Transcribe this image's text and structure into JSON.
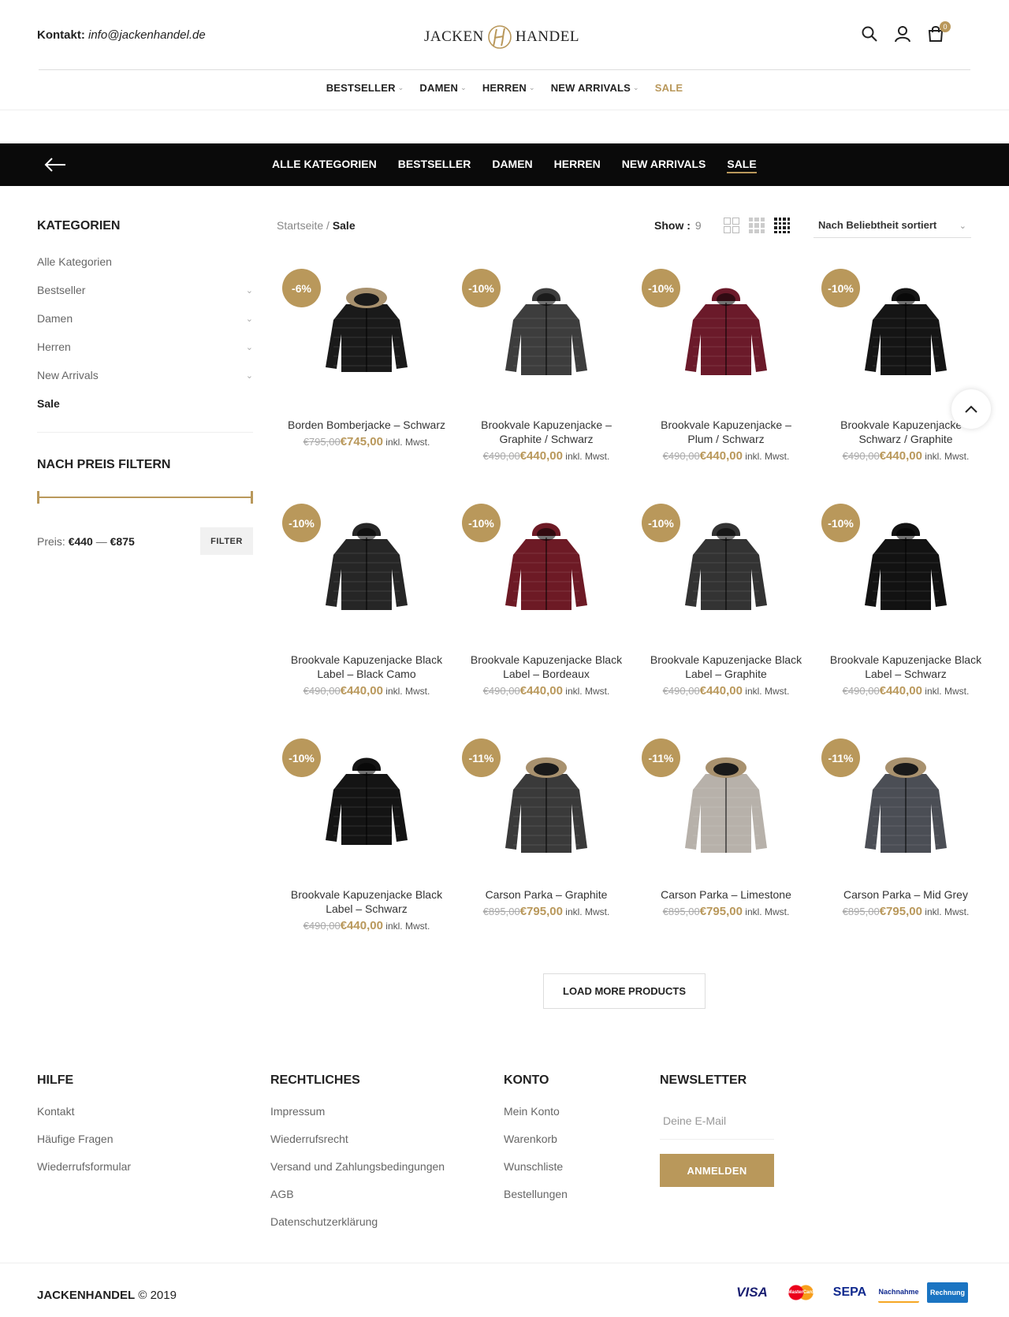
{
  "header": {
    "contact_label": "Kontakt:",
    "contact_email": "info@jackenhandel.de",
    "logo_left": "JACKEN",
    "logo_right": "HANDEL",
    "cart_count": "0"
  },
  "mainnav": [
    {
      "label": "BESTSELLER",
      "chev": "⌄"
    },
    {
      "label": "DAMEN",
      "chev": "⌄"
    },
    {
      "label": "HERREN",
      "chev": "⌄"
    },
    {
      "label": "NEW ARRIVALS",
      "chev": "⌄"
    },
    {
      "label": "SALE",
      "chev": ""
    }
  ],
  "catbar": {
    "items": [
      "ALLE KATEGORIEN",
      "BESTSELLER",
      "DAMEN",
      "HERREN",
      "NEW ARRIVALS",
      "SALE"
    ],
    "active": "SALE"
  },
  "sidebar": {
    "title": "KATEGORIEN",
    "items": [
      "Alle Kategorien",
      "Bestseller",
      "Damen",
      "Herren",
      "New Arrivals",
      "Sale"
    ],
    "price_title": "NACH PREIS FILTERN",
    "price_label": "Preis:",
    "price_min": "€440",
    "price_sep": "—",
    "price_max": "€875",
    "filter_button": "FILTER"
  },
  "toolbar": {
    "breadcrumb_home": "Startseite",
    "breadcrumb_sep": "/",
    "breadcrumb_current": "Sale",
    "show_label": "Show :",
    "show_value": "9",
    "sort_label": "Nach Beliebtheit sortiert"
  },
  "products": [
    {
      "badge": "-6%",
      "name": "Borden Bomberjacke – Schwarz",
      "old": "€795,00",
      "new": "€745,00",
      "color": "#1a1a1a",
      "style": "bomber"
    },
    {
      "badge": "-10%",
      "name": "Brookvale Kapuzenjacke – Graphite / Schwarz",
      "old": "€490,00",
      "new": "€440,00",
      "color": "#3d3d3d",
      "style": "hood"
    },
    {
      "badge": "-10%",
      "name": "Brookvale Kapuzenjacke – Plum / Schwarz",
      "old": "€490,00",
      "new": "€440,00",
      "color": "#6b1a2a",
      "style": "hood"
    },
    {
      "badge": "-10%",
      "name": "Brookvale Kapuzenjacke – Schwarz / Graphite",
      "old": "€490,00",
      "new": "€440,00",
      "color": "#151515",
      "style": "hood"
    },
    {
      "badge": "-10%",
      "name": "Brookvale Kapuzenjacke Black Label – Black Camo",
      "old": "€490,00",
      "new": "€440,00",
      "color": "#262626",
      "style": "hood"
    },
    {
      "badge": "-10%",
      "name": "Brookvale Kapuzenjacke Black Label – Bordeaux",
      "old": "€490,00",
      "new": "€440,00",
      "color": "#6d1a25",
      "style": "hood"
    },
    {
      "badge": "-10%",
      "name": "Brookvale Kapuzenjacke Black Label – Graphite",
      "old": "€490,00",
      "new": "€440,00",
      "color": "#333333",
      "style": "hood"
    },
    {
      "badge": "-10%",
      "name": "Brookvale Kapuzenjacke Black Label – Schwarz",
      "old": "€490,00",
      "new": "€440,00",
      "color": "#121212",
      "style": "hood"
    },
    {
      "badge": "-10%",
      "name": "Brookvale Kapuzenjacke Black Label – Schwarz",
      "old": "€490,00",
      "new": "€440,00",
      "color": "#141414",
      "style": "hood"
    },
    {
      "badge": "-11%",
      "name": "Carson Parka – Graphite",
      "old": "€895,00",
      "new": "€795,00",
      "color": "#3a3a3a",
      "style": "parka"
    },
    {
      "badge": "-11%",
      "name": "Carson Parka – Limestone",
      "old": "€895,00",
      "new": "€795,00",
      "color": "#b7b1aa",
      "style": "parka"
    },
    {
      "badge": "-11%",
      "name": "Carson Parka – Mid Grey",
      "old": "€895,00",
      "new": "€795,00",
      "color": "#4b4e55",
      "style": "parka"
    }
  ],
  "tax_note": "inkl. Mwst.",
  "load_more": "LOAD MORE PRODUCTS",
  "footer": {
    "hilfe": {
      "title": "HILFE",
      "links": [
        "Kontakt",
        "Häufige Fragen",
        "Wiederrufsformular"
      ]
    },
    "rechtliches": {
      "title": "RECHTLICHES",
      "links": [
        "Impressum",
        "Wiederrufsrecht",
        "Versand und Zahlungsbedingungen",
        "AGB",
        "Datenschutzerklärung"
      ]
    },
    "konto": {
      "title": "KONTO",
      "links": [
        "Mein Konto",
        "Warenkorb",
        "Wunschliste",
        "Bestellungen"
      ]
    },
    "newsletter": {
      "title": "NEWSLETTER",
      "placeholder": "Deine E-Mail",
      "button": "ANMELDEN"
    }
  },
  "bottom": {
    "brand": "JACKENHANDEL",
    "copy": "© 2019",
    "payments": [
      "VISA",
      "MasterCard",
      "SEPA",
      "Nachnahme",
      "Rechnung"
    ]
  },
  "colors": {
    "accent": "#b9985b",
    "bar": "#0a0a0a"
  }
}
